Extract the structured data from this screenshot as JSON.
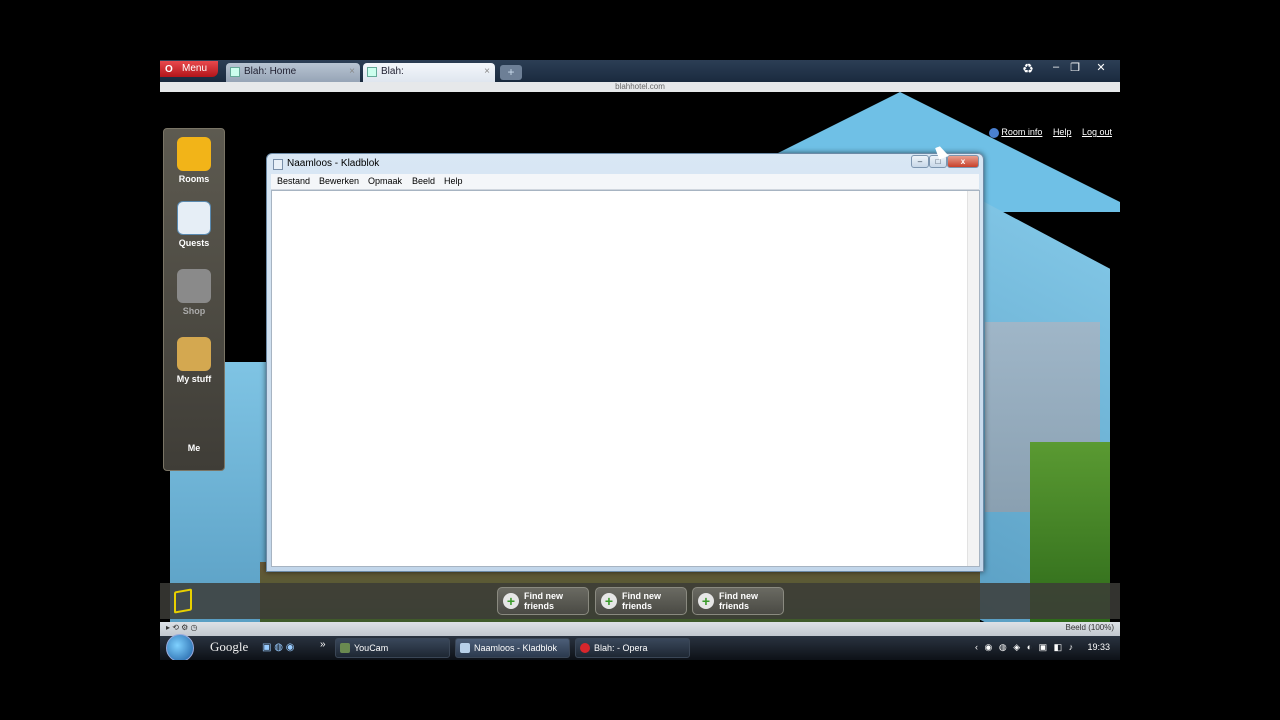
{
  "browser": {
    "menu_label": "Menu",
    "tabs": [
      {
        "label": "Blah: Home",
        "close": "×"
      },
      {
        "label": "Blah:",
        "close": "×"
      }
    ],
    "new_tab": "+",
    "address": "blahhotel.com",
    "zoom_label": "Beeld (100%)",
    "window_controls": {
      "minimize": "–",
      "restore": "❐",
      "close": "✕"
    }
  },
  "game": {
    "room_links": {
      "room_info": "Room info",
      "help": "Help",
      "logout": "Log out"
    },
    "sidebar": [
      {
        "label": "Rooms",
        "color": "#f2b418"
      },
      {
        "label": "Quests",
        "color": "#e6eef6"
      },
      {
        "label": "Shop",
        "color": "#8a8a8a"
      },
      {
        "label": "My stuff",
        "color": "#d4a850"
      },
      {
        "label": "Me",
        "color": ""
      }
    ],
    "friend_buttons": [
      {
        "line1": "Find new",
        "line2": "friends"
      },
      {
        "line1": "Find new",
        "line2": "friends"
      },
      {
        "line1": "Find new",
        "line2": "friends"
      }
    ]
  },
  "notepad": {
    "title": "Naamloos - Kladblok",
    "menus": [
      "Bestand",
      "Bewerken",
      "Opmaak",
      "Beeld",
      "Help"
    ],
    "controls": {
      "minimize": "–",
      "restore": "□",
      "close": "x"
    }
  },
  "taskbar": {
    "search_brand": "Google",
    "tasks": [
      {
        "label": "YouCam",
        "color": "#6a8a50"
      },
      {
        "label": "Naamloos - Kladblok",
        "color": "#b8d0e8"
      },
      {
        "label": "Blah: - Opera",
        "color": "#d8262c"
      }
    ],
    "clock": "19:33",
    "overflow": "»"
  }
}
